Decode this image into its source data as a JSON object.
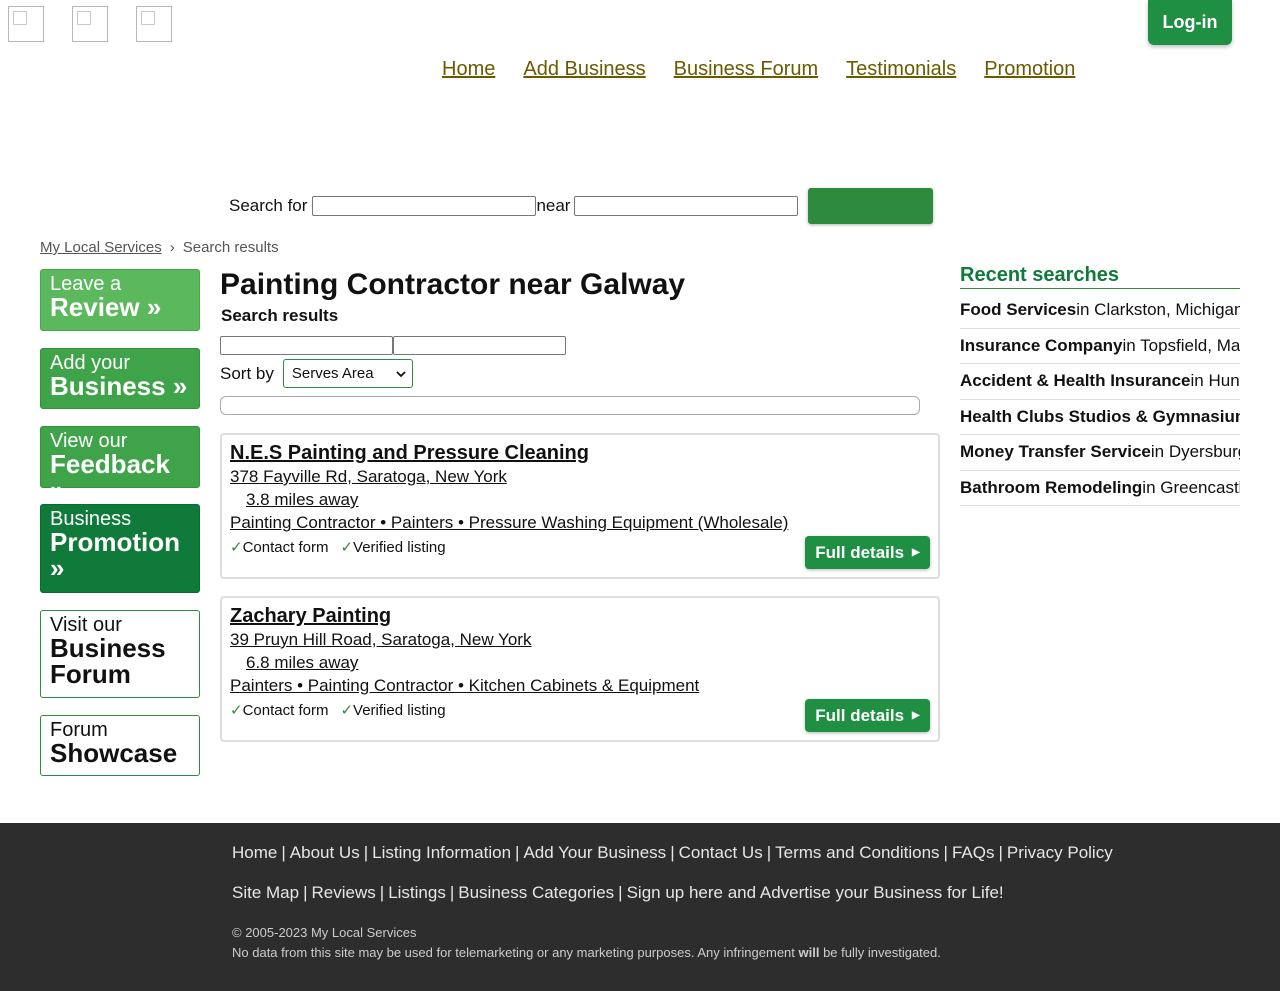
{
  "header": {
    "logos": [
      "logo-icon-1",
      "logo-icon-2",
      "logo-icon-3"
    ],
    "login_label": "Log-in",
    "nav": [
      "Home",
      "Add Business",
      "Business Forum",
      "Testimonials",
      "Promotion"
    ]
  },
  "search": {
    "search_for_label": "Search for",
    "near_label": "near",
    "query_value": "",
    "location_value": ""
  },
  "breadcrumb": {
    "home": "My Local Services",
    "separator": "›",
    "current": "Search results"
  },
  "promos": [
    {
      "small": "Leave a",
      "big": "Review »"
    },
    {
      "small": "Add your",
      "big": "Business »"
    },
    {
      "small": "View our",
      "big": "Feedback »"
    },
    {
      "small": "Business",
      "big": "Promotion »"
    },
    {
      "small": "Visit our",
      "big": "Business Forum"
    },
    {
      "small": "Forum",
      "big": "Showcase"
    }
  ],
  "main": {
    "title": "Painting Contractor near Galway",
    "subtitle": "Search results",
    "sort_label": "Sort by",
    "sort_value": "Serves Area",
    "listings": [
      {
        "name": "N.E.S Painting and Pressure Cleaning",
        "address": "378 Fayville Rd, Saratoga, New York",
        "distance": "3.8 miles away",
        "categories": "Painting Contractor • Painters • Pressure Washing Equipment (Wholesale)",
        "feature1": "Contact form",
        "feature2": "Verified listing",
        "button": "Full details"
      },
      {
        "name": "Zachary Painting",
        "address": "39 Pruyn Hill Road, Saratoga, New York",
        "distance": "6.8 miles away",
        "categories": "Painters • Painting Contractor • Kitchen Cabinets & Equipment",
        "feature1": "Contact form",
        "feature2": "Verified listing",
        "button": "Full details"
      }
    ]
  },
  "recent": {
    "title": "Recent searches",
    "items": [
      {
        "what": "Food Services",
        "where": "in Clarkston, Michigan"
      },
      {
        "what": "Insurance Company",
        "where": "in Topsfield, Massachusetts"
      },
      {
        "what": "Accident & Health Insurance",
        "where": "in Huntington"
      },
      {
        "what": "Health Clubs Studios & Gymnasiums",
        "where": ""
      },
      {
        "what": "Money Transfer Service",
        "where": "in Dyersburg"
      },
      {
        "what": "Bathroom Remodeling",
        "where": "in Greencastle"
      }
    ]
  },
  "footer": {
    "row1": [
      "Home",
      "About Us",
      "Listing Information",
      "Add Your Business",
      "Contact Us",
      "Terms and Conditions",
      "FAQs",
      "Privacy Policy"
    ],
    "row2": [
      "Site Map",
      "Reviews",
      "Listings",
      "Business Categories",
      "Sign up here and Advertise your Business for Life!"
    ],
    "separator": "|",
    "copyright": "© 2005-2023 My Local Services",
    "disclaimer_before": "No data from this site may be used for telemarketing or any marketing purposes. Any infringement ",
    "disclaimer_bold": "will",
    "disclaimer_after": " be fully investigated."
  },
  "colors": {
    "brand_green": "#1e8f43",
    "nav_link": "#6b5a00",
    "footer_bg": "#2d2d2d"
  }
}
